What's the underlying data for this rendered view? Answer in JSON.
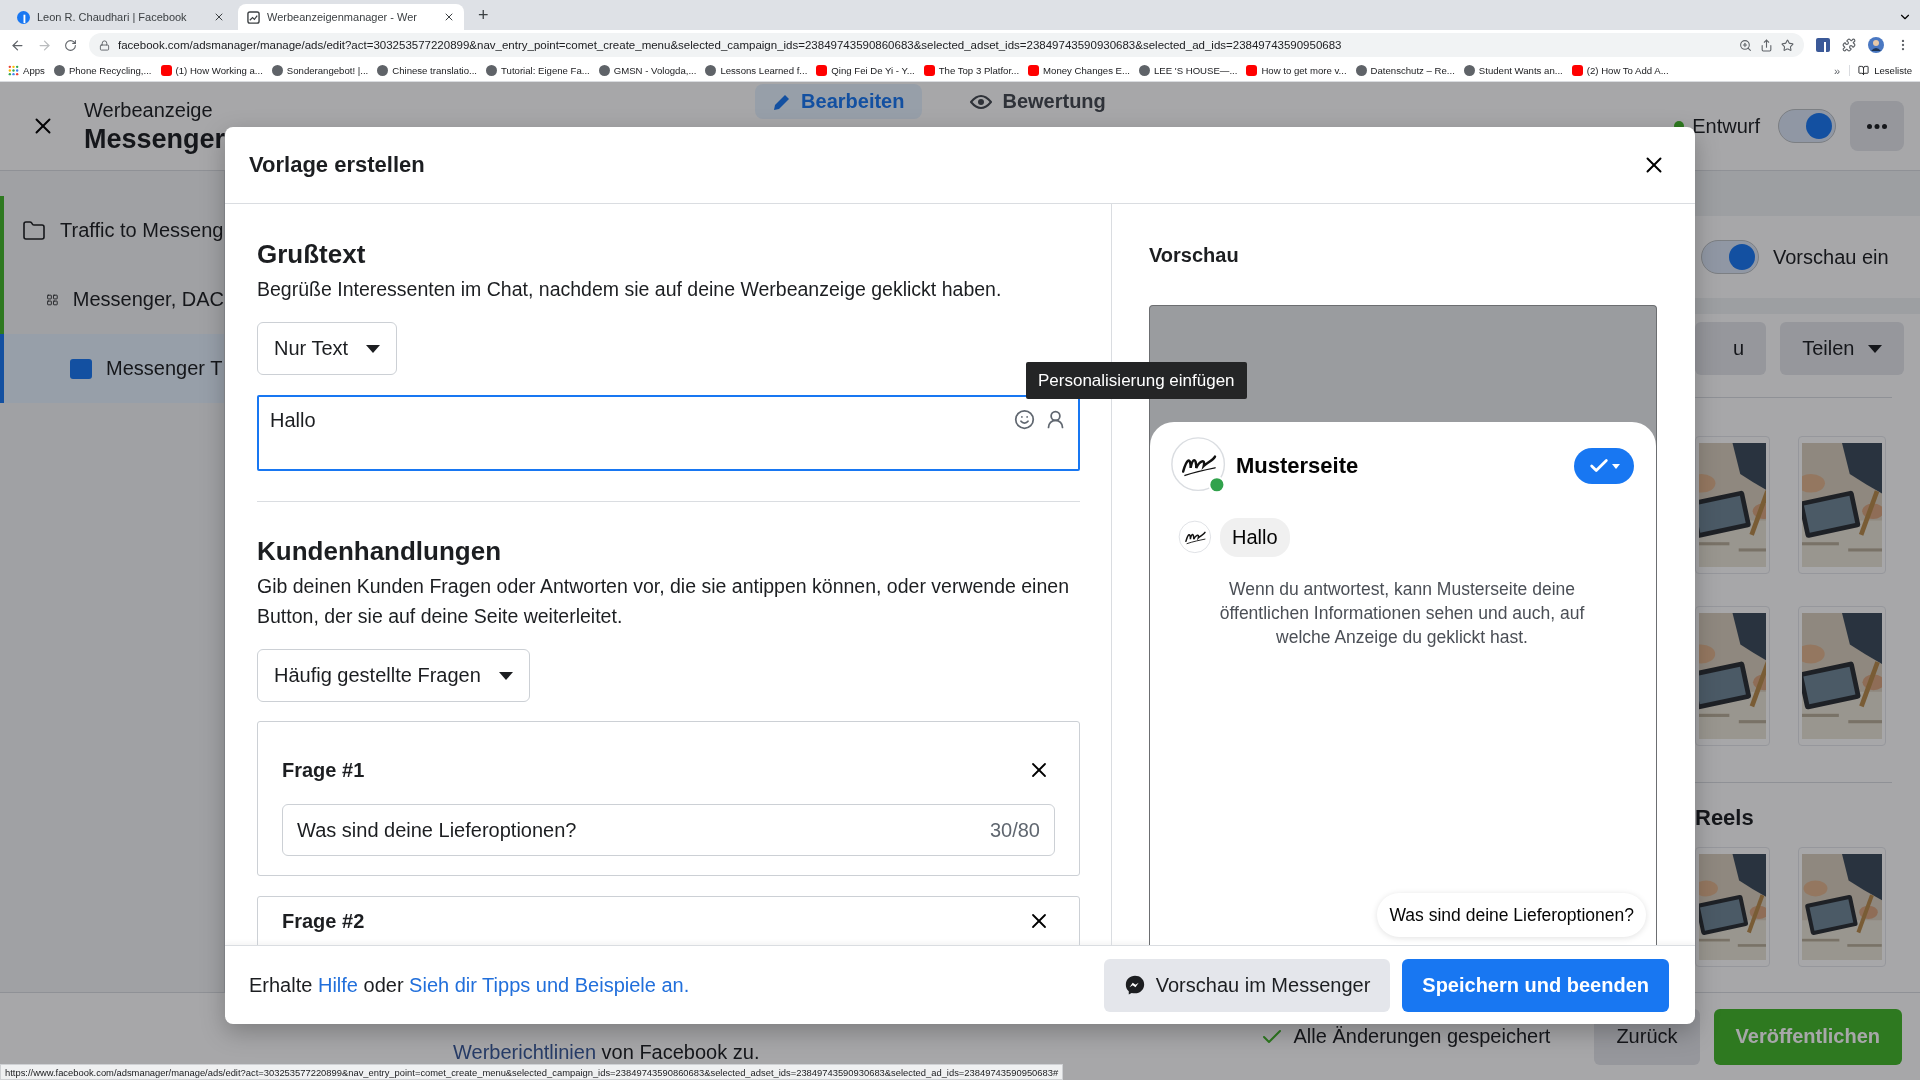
{
  "browser": {
    "tabs": [
      {
        "title": "Leon R. Chaudhari | Facebook",
        "kind": "facebook",
        "selected": false
      },
      {
        "title": "Werbeanzeigenmanager - Wer",
        "kind": "ads",
        "selected": true
      }
    ],
    "new_tab": "+",
    "url": "facebook.com/adsmanager/manage/ads/edit?act=303253577220899&nav_entry_point=comet_create_menu&selected_campaign_ids=23849743590860683&selected_adset_ids=23849743590930683&selected_ad_ids=23849743590950683",
    "bookmarks": [
      {
        "label": "Apps",
        "kind": "apps"
      },
      {
        "label": "Phone Recycling,...",
        "kind": "site"
      },
      {
        "label": "(1) How Working a...",
        "kind": "youtube"
      },
      {
        "label": "Sonderangebot! |...",
        "kind": "site"
      },
      {
        "label": "Chinese translatio...",
        "kind": "site"
      },
      {
        "label": "Tutorial: Eigene Fa...",
        "kind": "site"
      },
      {
        "label": "GMSN - Vologda,...",
        "kind": "site"
      },
      {
        "label": "Lessons Learned f...",
        "kind": "site"
      },
      {
        "label": "Qing Fei De Yi - Y...",
        "kind": "youtube"
      },
      {
        "label": "The Top 3 Platfor...",
        "kind": "youtube"
      },
      {
        "label": "Money Changes E...",
        "kind": "youtube"
      },
      {
        "label": "LEE 'S HOUSE—...",
        "kind": "site"
      },
      {
        "label": "How to get more v...",
        "kind": "youtube"
      },
      {
        "label": "Datenschutz – Re...",
        "kind": "site"
      },
      {
        "label": "Student Wants an...",
        "kind": "site"
      },
      {
        "label": "(2) How To Add A...",
        "kind": "youtube"
      }
    ],
    "more_bookmarks": "»",
    "reading_list": "Leseliste"
  },
  "page": {
    "header": {
      "subtitle": "Werbeanzeige",
      "title": "Messenger",
      "tabs": [
        {
          "label": "Bearbeiten",
          "kind": "edit",
          "selected": true
        },
        {
          "label": "Bewertung",
          "kind": "review",
          "selected": false
        }
      ],
      "status": "Entwurf",
      "toggle_on": true
    },
    "sidebar": {
      "items": [
        {
          "label": "Traffic to Messeng",
          "kind": "campaign",
          "selected": false,
          "children": [
            {
              "label": "Messenger, DAC",
              "kind": "adset",
              "selected": false,
              "children": [
                {
                  "label": "Messenger T",
                  "kind": "ad",
                  "selected": true
                }
              ]
            }
          ]
        }
      ]
    },
    "preview_panel": {
      "toggle": {
        "label": "Vorschau ein",
        "on": true
      },
      "buttons": [
        {
          "label": "u",
          "kind": "plain"
        },
        {
          "label": "Teilen",
          "kind": "menu"
        }
      ],
      "reels_heading": "Reels"
    },
    "footer": {
      "link": "Werberichtlinien",
      "text": "von Facebook zu.",
      "saved": "Alle Änderungen gespeichert",
      "buttons": [
        {
          "label": "Zurück",
          "kind": "secondary"
        },
        {
          "label": "Veröffentlichen",
          "kind": "primary"
        }
      ]
    }
  },
  "dialog": {
    "title": "Vorlage erstellen",
    "greeting": {
      "heading": "Grußtext",
      "description": "Begrüße Interessenten im Chat, nachdem sie auf deine Werbeanzeige geklickt haben.",
      "format": "Nur Text",
      "message": "Hallo",
      "tooltip": "Personalisierung einfügen"
    },
    "actions": {
      "heading": "Kundenhandlungen",
      "description": "Gib deinen Kunden Fragen oder Antworten vor, die sie antippen können, oder verwende einen Button, der sie auf deine Seite weiterleitet.",
      "type": "Häufig gestellte Fragen",
      "questions": [
        {
          "label": "Frage #1",
          "value": "Was sind deine Lieferoptionen?",
          "counter": "30/80"
        },
        {
          "label": "Frage #2"
        }
      ]
    },
    "preview": {
      "heading": "Vorschau",
      "page_name": "Musterseite",
      "message": "Hallo",
      "notice": "Wenn du antwortest, kann Musterseite deine öffentlichen Informationen sehen und auch, auf welche Anzeige du geklickt hast.",
      "quick_reply": "Was sind deine Lieferoptionen?"
    },
    "help": [
      {
        "text": "Erhalte",
        "kind": "text"
      },
      {
        "text": "Hilfe",
        "kind": "link"
      },
      {
        "text": "oder",
        "kind": "text"
      },
      {
        "text": "Sieh dir Tipps und Beispiele an.",
        "kind": "link"
      }
    ],
    "buttons": [
      {
        "label": "Vorschau im Messenger",
        "kind": "secondary"
      },
      {
        "label": "Speichern und beenden",
        "kind": "primary"
      }
    ]
  },
  "status_url": "https://www.facebook.com/adsmanager/manage/ads/edit?act=303253577220899&nav_entry_point=comet_create_menu&selected_campaign_ids=23849743590860683&selected_adset_ids=23849743590930683&selected_ad_ids=23849743590950683#"
}
